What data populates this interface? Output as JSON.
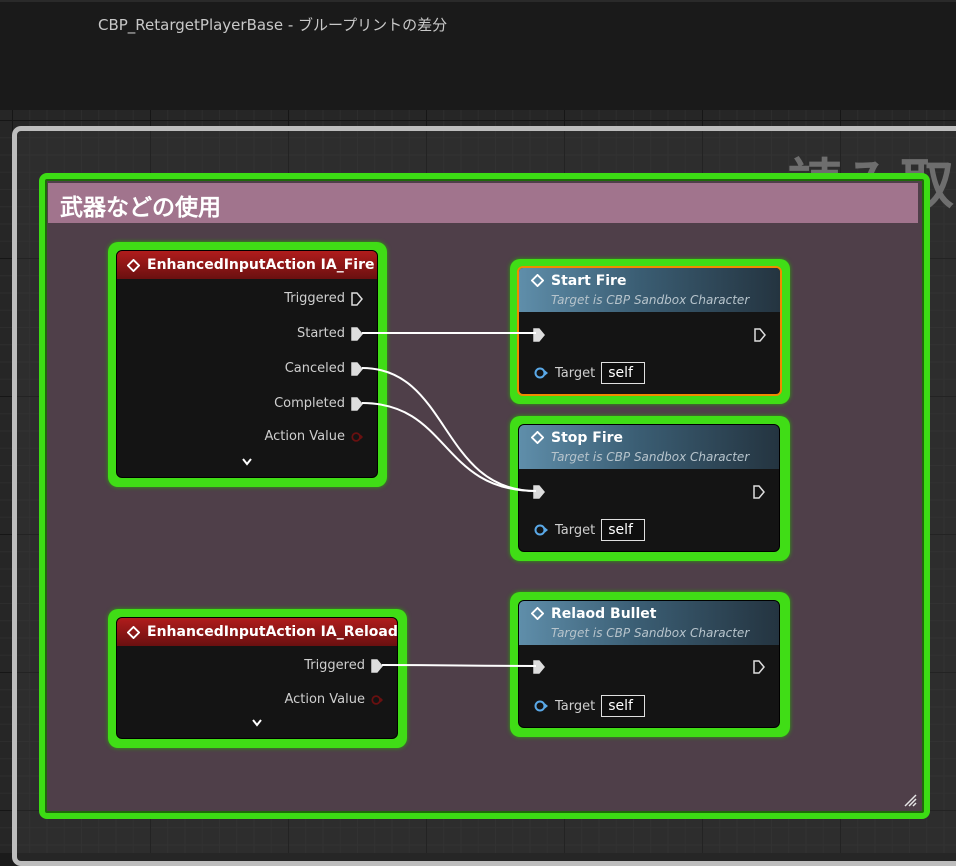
{
  "window": {
    "title": "CBP_RetargetPlayerBase - ブループリントの差分"
  },
  "outer_comment": {
    "title": "読み取"
  },
  "comment": {
    "title": "武器などの使用"
  },
  "nodes": {
    "ia_fire": {
      "title": "EnhancedInputAction IA_Fire",
      "pins": [
        "Triggered",
        "Started",
        "Canceled",
        "Completed",
        "Action Value"
      ]
    },
    "ia_reload": {
      "title": "EnhancedInputAction IA_Reload",
      "pins": [
        "Triggered",
        "Action Value"
      ]
    },
    "start_fire": {
      "title": "Start Fire",
      "subtitle": "Target is CBP Sandbox Character",
      "target_label": "Target",
      "target_value": "self"
    },
    "stop_fire": {
      "title": "Stop Fire",
      "subtitle": "Target is CBP Sandbox Character",
      "target_label": "Target",
      "target_value": "self"
    },
    "reload_bullet": {
      "title": "Relaod Bullet",
      "subtitle": "Target is CBP Sandbox Character",
      "target_label": "Target",
      "target_value": "self"
    }
  },
  "colors": {
    "selection_green": "#40dd16",
    "comment_header": "#a1748d",
    "comment_body": "#4f3f49",
    "event_header": "#b01c1c",
    "function_header": "#5f8eaa",
    "selected_orange": "#f08a00"
  }
}
